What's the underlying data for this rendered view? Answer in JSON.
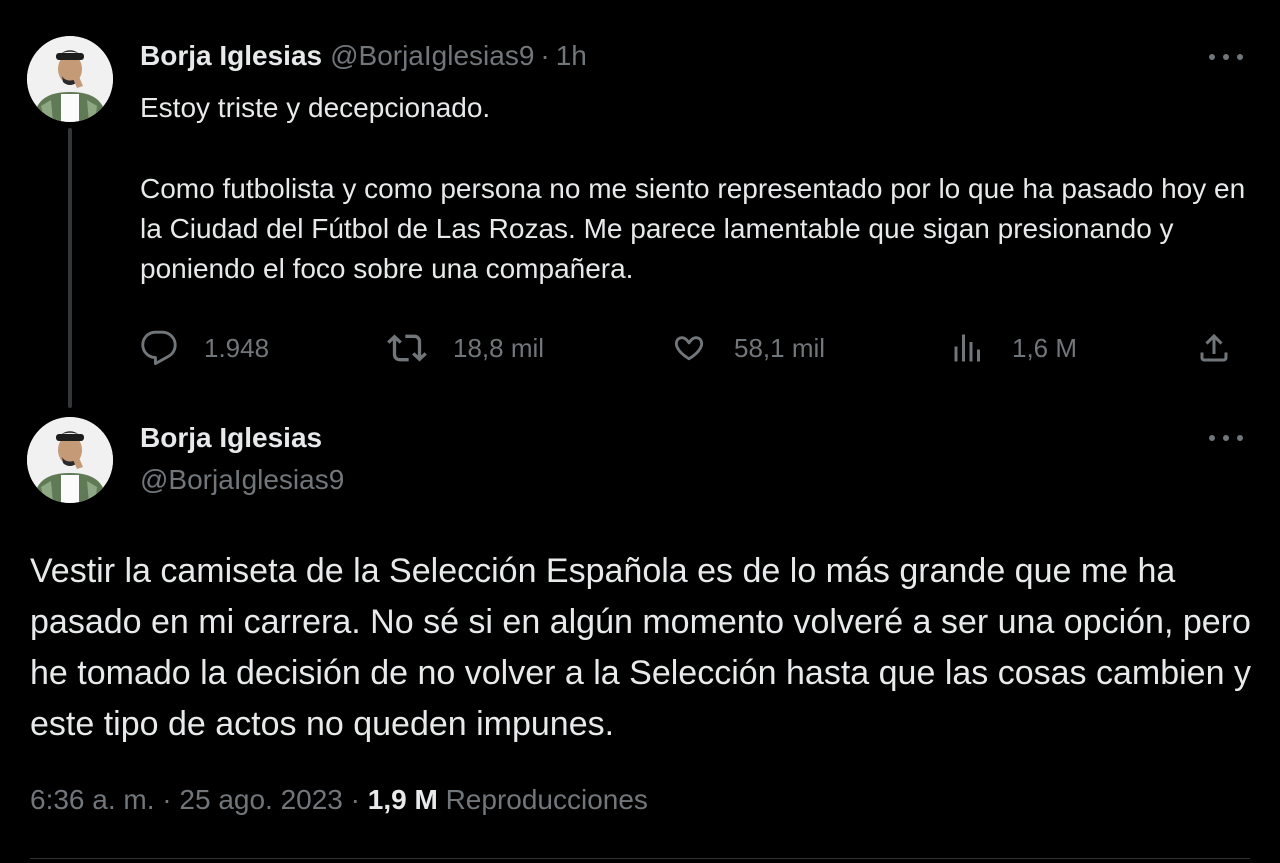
{
  "reply_tweet": {
    "author_name": "Borja Iglesias",
    "author_handle": "@BorjaIglesias9",
    "separator": "·",
    "time_ago": "1h",
    "text": [
      "Estoy triste y decepcionado.",
      "Como futbolista y como persona no me siento representado por lo que ha pasado hoy en la Ciudad del Fútbol de Las Rozas. Me parece lamentable que sigan presionando y poniendo el foco sobre una compañera."
    ],
    "actions": {
      "replies": "1.948",
      "retweets": "18,8 mil",
      "likes": "58,1 mil",
      "views": "1,6 M"
    }
  },
  "main_tweet": {
    "author_name": "Borja Iglesias",
    "author_handle": "@BorjaIglesias9",
    "text": "Vestir la camiseta de la Selección Española es de lo más grande que me ha pasado en mi carrera. No sé si en algún momento volveré a ser una opción, pero he tomado la decisión de no volver a la Selección hasta que las cosas cambien y este tipo de actos no queden impunes.",
    "timestamp": "6:36 a. m. · 25 ago. 2023 ·",
    "views_count": "1,9 M",
    "views_label": "Reproducciones"
  },
  "colors": {
    "background": "#000000",
    "text_primary": "#e7e9ea",
    "text_secondary": "#71767b",
    "thread_line": "#333639",
    "divider": "#2f3336"
  },
  "icons": {
    "reply": "speech-bubble-icon",
    "retweet": "retweet-arrows-icon",
    "like": "heart-icon",
    "views": "bar-chart-icon",
    "share": "share-upload-icon",
    "more": "ellipsis-icon"
  }
}
